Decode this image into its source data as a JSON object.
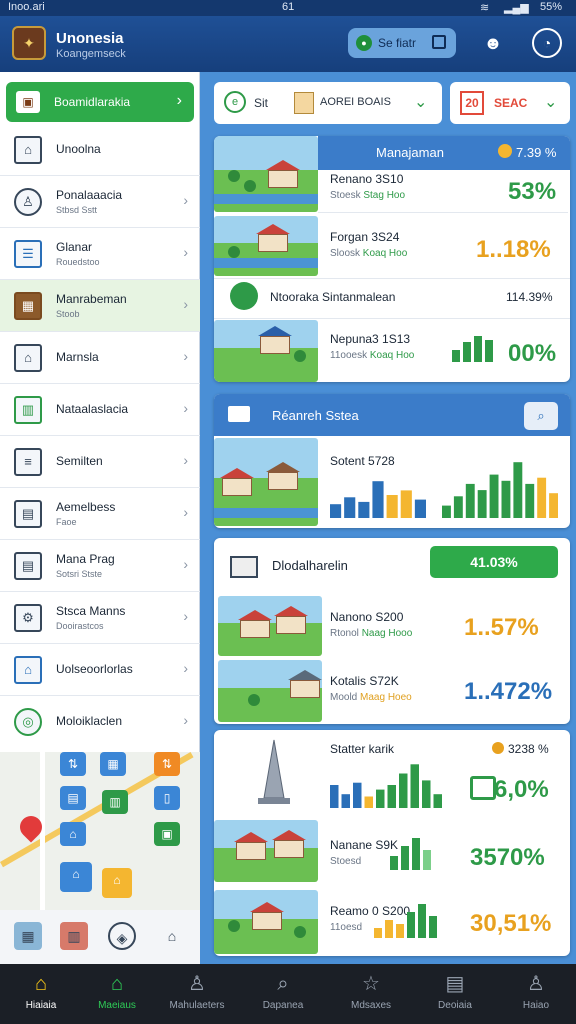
{
  "status_bar": {
    "carrier": "Inoo.ari",
    "time": "61",
    "battery": "55%"
  },
  "header": {
    "title": "Unonesia",
    "subtitle": "Koangemseck",
    "pill_text": "Se fiatr",
    "icons": [
      "emblem-icon",
      "robot-icon",
      "settings-ring-icon"
    ]
  },
  "sidebar": {
    "top_button": "Boamidlarakia",
    "items": [
      {
        "label": "Unoolna",
        "sub": "",
        "icon": "building-icon"
      },
      {
        "label": "Ponalaaacia",
        "sub": "Stbsd Sstt",
        "icon": "user-icon"
      },
      {
        "label": "Glanar",
        "sub": "Rouedstoo",
        "icon": "document-icon"
      },
      {
        "label": "Manrabeman",
        "sub": "Stoob",
        "icon": "box-icon"
      },
      {
        "label": "Marnsla",
        "sub": "",
        "icon": "house-icon"
      },
      {
        "label": "Nataalaslacia",
        "sub": "",
        "icon": "chart-icon"
      },
      {
        "label": "Semilten",
        "sub": "",
        "icon": "server-icon"
      },
      {
        "label": "Aemelbess",
        "sub": "Faoe",
        "icon": "clipboard-icon"
      },
      {
        "label": "Mana Prag",
        "sub": "Sotsri Stste",
        "icon": "file-icon"
      },
      {
        "label": "Stsca Manns",
        "sub": "Dooirastcos",
        "icon": "gear-building-icon"
      },
      {
        "label": "Uolseoorlorlas",
        "sub": "",
        "icon": "home-blue-icon"
      },
      {
        "label": "Moloiklaclen",
        "sub": "",
        "icon": "target-icon"
      }
    ]
  },
  "top_row": {
    "left_label": "Sit",
    "left_field": "AOREI BOAIS",
    "right_badge": "20",
    "right_label": "SEAC"
  },
  "card1": {
    "header_label": "Manajaman",
    "header_value": "7.39 %",
    "rows": [
      {
        "title": "Renano 3S10",
        "sub_a": "Stoesk",
        "sub_b": "Stag Hoo",
        "value": "53%",
        "color": "green"
      },
      {
        "title": "Forgan 3S24",
        "sub_a": "Sloosk",
        "sub_b": "Koaq Hoo",
        "value": "1..18%",
        "color": "mixed"
      },
      {
        "title": "Ntooraka Sintanmalean",
        "sub_a": "",
        "sub_b": "",
        "value": "114.39%",
        "color": "dark"
      },
      {
        "title": "Nepuna3 1S13",
        "sub_a": "11ooesk",
        "sub_b": "Koaq Hoo",
        "value": "00%",
        "color": "green"
      }
    ]
  },
  "card2": {
    "header_label": "Réanreh Sstea",
    "row": {
      "title": "Sotent 5728"
    },
    "chart_left": [
      {
        "h": 0.3,
        "c": "#2a6fb8"
      },
      {
        "h": 0.45,
        "c": "#2a6fb8"
      },
      {
        "h": 0.35,
        "c": "#2a6fb8"
      },
      {
        "h": 0.8,
        "c": "#2a6fb8"
      },
      {
        "h": 0.5,
        "c": "#f4b630"
      },
      {
        "h": 0.6,
        "c": "#f4b630"
      },
      {
        "h": 0.4,
        "c": "#2a6fb8"
      }
    ],
    "chart_right": [
      {
        "h": 0.2,
        "c": "#2e9a48"
      },
      {
        "h": 0.35,
        "c": "#2e9a48"
      },
      {
        "h": 0.55,
        "c": "#2e9a48"
      },
      {
        "h": 0.45,
        "c": "#2e9a48"
      },
      {
        "h": 0.7,
        "c": "#2e9a48"
      },
      {
        "h": 0.6,
        "c": "#2e9a48"
      },
      {
        "h": 0.9,
        "c": "#2e9a48"
      },
      {
        "h": 0.55,
        "c": "#2e9a48"
      },
      {
        "h": 0.65,
        "c": "#f4b630"
      },
      {
        "h": 0.4,
        "c": "#f4b630"
      }
    ]
  },
  "card3": {
    "header_label": "Dlodalharelin",
    "header_value": "41.03%",
    "rows": [
      {
        "title": "Nanono S200",
        "sub_a": "Rtonol",
        "sub_b": "Naag Hooo",
        "value": "1..57%"
      },
      {
        "title": "Kotalis S72K",
        "sub_a": "Moold",
        "sub_b": "Maag Hoeo",
        "value": "1..472%"
      }
    ]
  },
  "card4": {
    "title": "Statter karik",
    "header_value": "3238 %",
    "main_value": "6,0%",
    "chart_main": [
      {
        "h": 0.5,
        "c": "#2a6fb8"
      },
      {
        "h": 0.3,
        "c": "#2a6fb8"
      },
      {
        "h": 0.55,
        "c": "#2a6fb8"
      },
      {
        "h": 0.25,
        "c": "#f4b630"
      },
      {
        "h": 0.4,
        "c": "#2e9a48"
      },
      {
        "h": 0.5,
        "c": "#2e9a48"
      },
      {
        "h": 0.75,
        "c": "#2e9a48"
      },
      {
        "h": 0.95,
        "c": "#2e9a48"
      },
      {
        "h": 0.6,
        "c": "#2e9a48"
      },
      {
        "h": 0.3,
        "c": "#2e9a48"
      }
    ],
    "rows": [
      {
        "title": "Nanane S9K",
        "sub": "Stoesd",
        "value": "3570%"
      },
      {
        "title": "Reamo 0 S200",
        "sub": "11oesd",
        "value": "30,51%"
      }
    ]
  },
  "bottom_nav": [
    {
      "label": "Hiaiaia",
      "icon": "home-icon"
    },
    {
      "label": "Maeiaus",
      "icon": "house-outline-icon"
    },
    {
      "label": "Mahulaeters",
      "icon": "person-icon"
    },
    {
      "label": "Dapanea",
      "icon": "search-icon"
    },
    {
      "label": "Mdsaxes",
      "icon": "star-icon"
    },
    {
      "label": "Deoiaia",
      "icon": "calendar-icon"
    },
    {
      "label": "Haiao",
      "icon": "profile-icon"
    }
  ],
  "colors": {
    "primary": "#1f5096",
    "accent_green": "#2e9a48",
    "accent_orange": "#e8a11f",
    "accent_blue": "#2a6fb8"
  }
}
